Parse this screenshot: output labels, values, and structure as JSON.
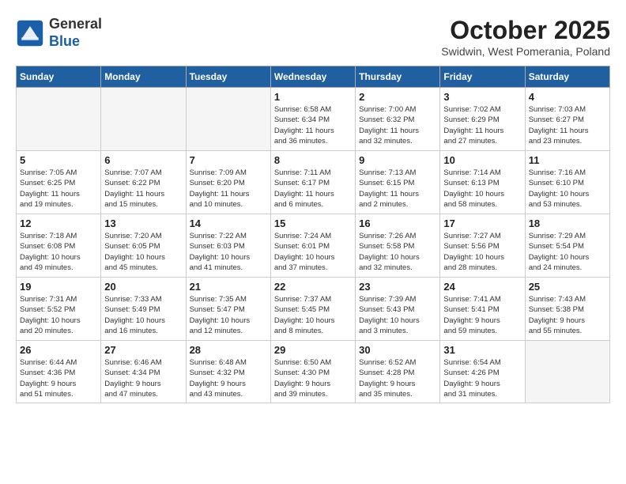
{
  "header": {
    "logo_general": "General",
    "logo_blue": "Blue",
    "month": "October 2025",
    "location": "Swidwin, West Pomerania, Poland"
  },
  "days_of_week": [
    "Sunday",
    "Monday",
    "Tuesday",
    "Wednesday",
    "Thursday",
    "Friday",
    "Saturday"
  ],
  "weeks": [
    [
      {
        "day": "",
        "info": ""
      },
      {
        "day": "",
        "info": ""
      },
      {
        "day": "",
        "info": ""
      },
      {
        "day": "1",
        "info": "Sunrise: 6:58 AM\nSunset: 6:34 PM\nDaylight: 11 hours\nand 36 minutes."
      },
      {
        "day": "2",
        "info": "Sunrise: 7:00 AM\nSunset: 6:32 PM\nDaylight: 11 hours\nand 32 minutes."
      },
      {
        "day": "3",
        "info": "Sunrise: 7:02 AM\nSunset: 6:29 PM\nDaylight: 11 hours\nand 27 minutes."
      },
      {
        "day": "4",
        "info": "Sunrise: 7:03 AM\nSunset: 6:27 PM\nDaylight: 11 hours\nand 23 minutes."
      }
    ],
    [
      {
        "day": "5",
        "info": "Sunrise: 7:05 AM\nSunset: 6:25 PM\nDaylight: 11 hours\nand 19 minutes."
      },
      {
        "day": "6",
        "info": "Sunrise: 7:07 AM\nSunset: 6:22 PM\nDaylight: 11 hours\nand 15 minutes."
      },
      {
        "day": "7",
        "info": "Sunrise: 7:09 AM\nSunset: 6:20 PM\nDaylight: 11 hours\nand 10 minutes."
      },
      {
        "day": "8",
        "info": "Sunrise: 7:11 AM\nSunset: 6:17 PM\nDaylight: 11 hours\nand 6 minutes."
      },
      {
        "day": "9",
        "info": "Sunrise: 7:13 AM\nSunset: 6:15 PM\nDaylight: 11 hours\nand 2 minutes."
      },
      {
        "day": "10",
        "info": "Sunrise: 7:14 AM\nSunset: 6:13 PM\nDaylight: 10 hours\nand 58 minutes."
      },
      {
        "day": "11",
        "info": "Sunrise: 7:16 AM\nSunset: 6:10 PM\nDaylight: 10 hours\nand 53 minutes."
      }
    ],
    [
      {
        "day": "12",
        "info": "Sunrise: 7:18 AM\nSunset: 6:08 PM\nDaylight: 10 hours\nand 49 minutes."
      },
      {
        "day": "13",
        "info": "Sunrise: 7:20 AM\nSunset: 6:05 PM\nDaylight: 10 hours\nand 45 minutes."
      },
      {
        "day": "14",
        "info": "Sunrise: 7:22 AM\nSunset: 6:03 PM\nDaylight: 10 hours\nand 41 minutes."
      },
      {
        "day": "15",
        "info": "Sunrise: 7:24 AM\nSunset: 6:01 PM\nDaylight: 10 hours\nand 37 minutes."
      },
      {
        "day": "16",
        "info": "Sunrise: 7:26 AM\nSunset: 5:58 PM\nDaylight: 10 hours\nand 32 minutes."
      },
      {
        "day": "17",
        "info": "Sunrise: 7:27 AM\nSunset: 5:56 PM\nDaylight: 10 hours\nand 28 minutes."
      },
      {
        "day": "18",
        "info": "Sunrise: 7:29 AM\nSunset: 5:54 PM\nDaylight: 10 hours\nand 24 minutes."
      }
    ],
    [
      {
        "day": "19",
        "info": "Sunrise: 7:31 AM\nSunset: 5:52 PM\nDaylight: 10 hours\nand 20 minutes."
      },
      {
        "day": "20",
        "info": "Sunrise: 7:33 AM\nSunset: 5:49 PM\nDaylight: 10 hours\nand 16 minutes."
      },
      {
        "day": "21",
        "info": "Sunrise: 7:35 AM\nSunset: 5:47 PM\nDaylight: 10 hours\nand 12 minutes."
      },
      {
        "day": "22",
        "info": "Sunrise: 7:37 AM\nSunset: 5:45 PM\nDaylight: 10 hours\nand 8 minutes."
      },
      {
        "day": "23",
        "info": "Sunrise: 7:39 AM\nSunset: 5:43 PM\nDaylight: 10 hours\nand 3 minutes."
      },
      {
        "day": "24",
        "info": "Sunrise: 7:41 AM\nSunset: 5:41 PM\nDaylight: 9 hours\nand 59 minutes."
      },
      {
        "day": "25",
        "info": "Sunrise: 7:43 AM\nSunset: 5:38 PM\nDaylight: 9 hours\nand 55 minutes."
      }
    ],
    [
      {
        "day": "26",
        "info": "Sunrise: 6:44 AM\nSunset: 4:36 PM\nDaylight: 9 hours\nand 51 minutes."
      },
      {
        "day": "27",
        "info": "Sunrise: 6:46 AM\nSunset: 4:34 PM\nDaylight: 9 hours\nand 47 minutes."
      },
      {
        "day": "28",
        "info": "Sunrise: 6:48 AM\nSunset: 4:32 PM\nDaylight: 9 hours\nand 43 minutes."
      },
      {
        "day": "29",
        "info": "Sunrise: 6:50 AM\nSunset: 4:30 PM\nDaylight: 9 hours\nand 39 minutes."
      },
      {
        "day": "30",
        "info": "Sunrise: 6:52 AM\nSunset: 4:28 PM\nDaylight: 9 hours\nand 35 minutes."
      },
      {
        "day": "31",
        "info": "Sunrise: 6:54 AM\nSunset: 4:26 PM\nDaylight: 9 hours\nand 31 minutes."
      },
      {
        "day": "",
        "info": ""
      }
    ]
  ]
}
